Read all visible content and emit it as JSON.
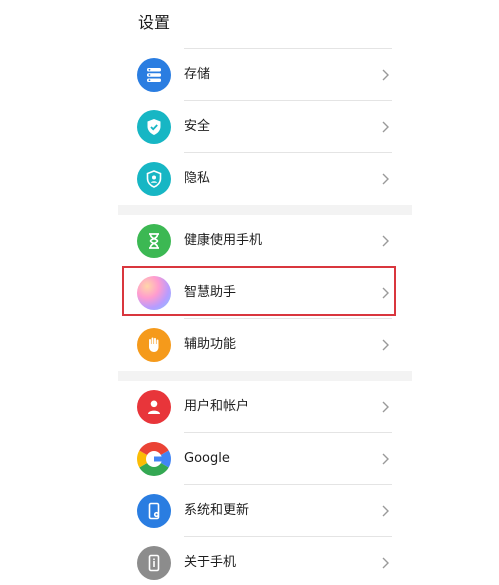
{
  "header": {
    "title": "设置"
  },
  "groups": [
    {
      "items": [
        {
          "label": "存储",
          "icon": "storage-icon",
          "color": "#2a7de1"
        },
        {
          "label": "安全",
          "icon": "shield-check-icon",
          "color": "#17b6c4"
        },
        {
          "label": "隐私",
          "icon": "privacy-shield-icon",
          "color": "#17b6c4"
        }
      ]
    },
    {
      "items": [
        {
          "label": "健康使用手机",
          "icon": "hourglass-icon",
          "color": "#3cb853"
        },
        {
          "label": "智慧助手",
          "icon": "smart-assistant-icon",
          "color": "gradient",
          "highlighted": true
        },
        {
          "label": "辅助功能",
          "icon": "hand-icon",
          "color": "#f59a1b"
        }
      ]
    },
    {
      "items": [
        {
          "label": "用户和帐户",
          "icon": "user-icon",
          "color": "#e8353a"
        },
        {
          "label": "Google",
          "icon": "google-icon",
          "color": "#ffffff"
        },
        {
          "label": "系统和更新",
          "icon": "system-update-icon",
          "color": "#2a7de1"
        },
        {
          "label": "关于手机",
          "icon": "phone-info-icon",
          "color": "#8c8c8c"
        }
      ]
    }
  ],
  "highlight_color": "#d9363e"
}
